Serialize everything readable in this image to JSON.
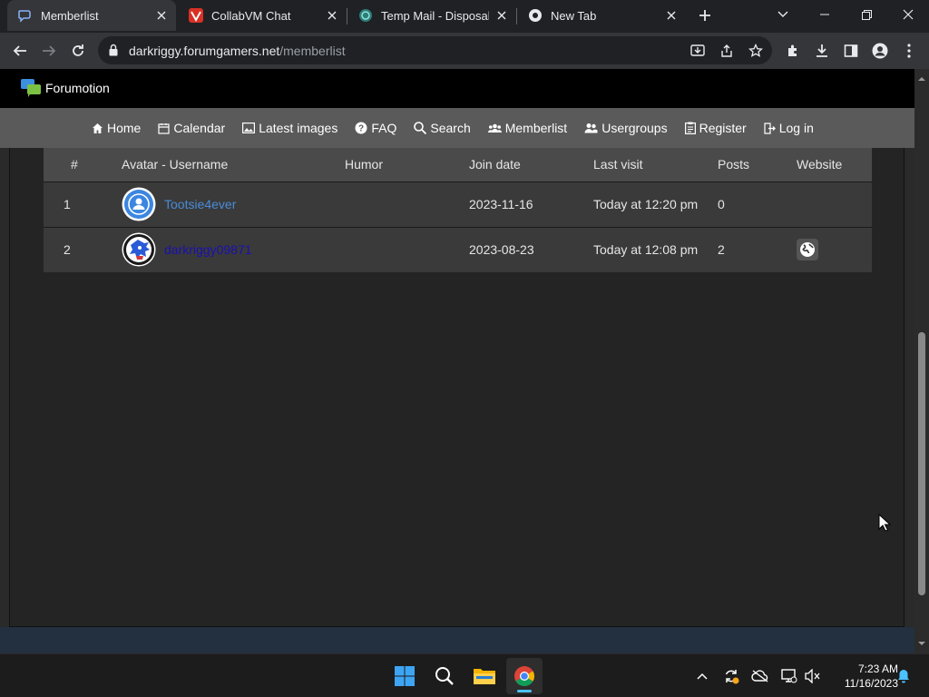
{
  "browser": {
    "tabs": [
      {
        "title": "Memberlist",
        "active": true
      },
      {
        "title": "CollabVM Chat",
        "active": false
      },
      {
        "title": "Temp Mail - Disposable",
        "active": false
      },
      {
        "title": "New Tab",
        "active": false
      }
    ],
    "url_host": "darkriggy.forumgamers.net",
    "url_path": "/memberlist"
  },
  "site": {
    "brand": "Forumotion",
    "nav": [
      {
        "label": "Home",
        "icon": "home-icon"
      },
      {
        "label": "Calendar",
        "icon": "calendar-icon"
      },
      {
        "label": "Latest images",
        "icon": "image-icon"
      },
      {
        "label": "FAQ",
        "icon": "faq-icon"
      },
      {
        "label": "Search",
        "icon": "search-icon"
      },
      {
        "label": "Memberlist",
        "icon": "members-icon"
      },
      {
        "label": "Usergroups",
        "icon": "usergroups-icon"
      },
      {
        "label": "Register",
        "icon": "register-icon"
      },
      {
        "label": "Log in",
        "icon": "login-icon"
      }
    ]
  },
  "memberlist": {
    "headers": [
      "#",
      "Avatar - Username",
      "Humor",
      "Join date",
      "Last visit",
      "Posts",
      "Website"
    ],
    "rows": [
      {
        "num": "1",
        "username": "Tootsie4ever",
        "humor": "",
        "join_date": "2023-11-16",
        "last_visit": "Today at 12:20 pm",
        "posts": "0",
        "website": false
      },
      {
        "num": "2",
        "username": "darkriggy09871",
        "humor": "",
        "join_date": "2023-08-23",
        "last_visit": "Today at 12:08 pm",
        "posts": "2",
        "website": true
      }
    ]
  },
  "taskbar": {
    "time": "7:23 AM",
    "date": "11/16/2023"
  },
  "colors": {
    "accent": "#4cc2ff",
    "username_link": "#4a8bd6",
    "username_visited": "#1a10b0"
  }
}
